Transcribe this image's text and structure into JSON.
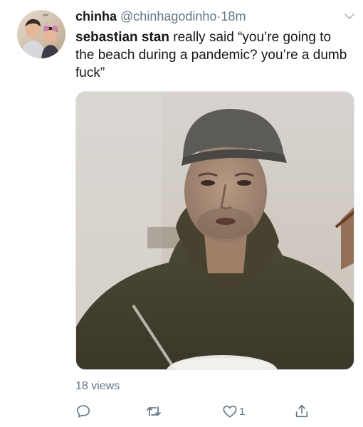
{
  "tweet": {
    "author": {
      "display_name": "chinha",
      "handle": "@chinhagodinho",
      "separator": "·",
      "timestamp": "18m"
    },
    "text": {
      "mention": "sebastian stan",
      "body": " really said “you’re going to the beach during a pandemic? you’re a dumb fuck”"
    },
    "media": {
      "type": "video-thumbnail"
    },
    "views": "18 views",
    "actions": {
      "reply_icon": "reply-icon",
      "retweet_icon": "retweet-icon",
      "like_icon": "heart-icon",
      "like_count": "1",
      "share_icon": "share-icon"
    },
    "colors": {
      "text_primary": "#14171a",
      "text_secondary": "#657786",
      "divider": "#e1e8ed"
    }
  }
}
